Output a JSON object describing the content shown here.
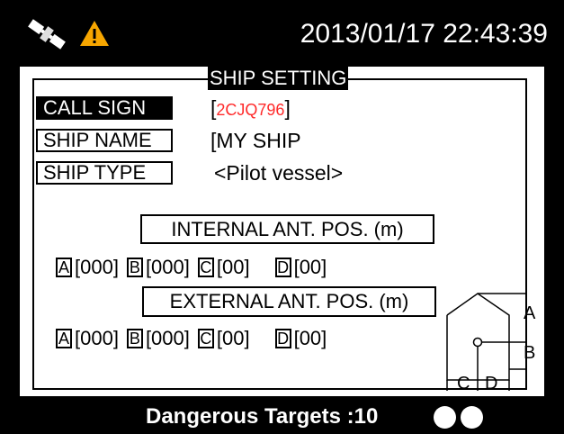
{
  "status_bar": {
    "datetime": "2013/01/17 22:43:39",
    "icons": [
      "satellite-icon",
      "warning-icon"
    ],
    "warning_color": "#f7a600"
  },
  "ship_setting": {
    "title": "SHIP SETTING",
    "fields": {
      "call_sign": {
        "label": "CALL SIGN",
        "bracket_open": "[",
        "value": "2CJQ796",
        "bracket_close": "]",
        "selected": true
      },
      "ship_name": {
        "label": "SHIP NAME",
        "value": "[MY SHIP"
      },
      "ship_type": {
        "label": "SHIP TYPE",
        "value": "<Pilot vessel>"
      }
    },
    "internal_ant": {
      "heading": "INTERNAL ANT. POS. (m)",
      "a": {
        "letter": "A",
        "value": "[000]"
      },
      "b": {
        "letter": "B",
        "value": "[000]"
      },
      "c": {
        "letter": "C",
        "value": "[00]"
      },
      "d": {
        "letter": "D",
        "value": "[00]"
      }
    },
    "external_ant": {
      "heading": "EXTERNAL ANT. POS. (m)",
      "a": {
        "letter": "A",
        "value": "[000]"
      },
      "b": {
        "letter": "B",
        "value": "[000]"
      },
      "c": {
        "letter": "C",
        "value": "[00]"
      },
      "d": {
        "letter": "D",
        "value": "[00]"
      }
    },
    "diagram": {
      "labels": {
        "a": "A",
        "b": "B",
        "c": "C",
        "d": "D"
      }
    }
  },
  "bottom_bar": {
    "dangerous_targets": "Dangerous Targets :10",
    "indicator_count": 2
  },
  "colors": {
    "background": "#000000",
    "panel": "#ffffff",
    "call_sign_value": "#ff2a2a"
  }
}
